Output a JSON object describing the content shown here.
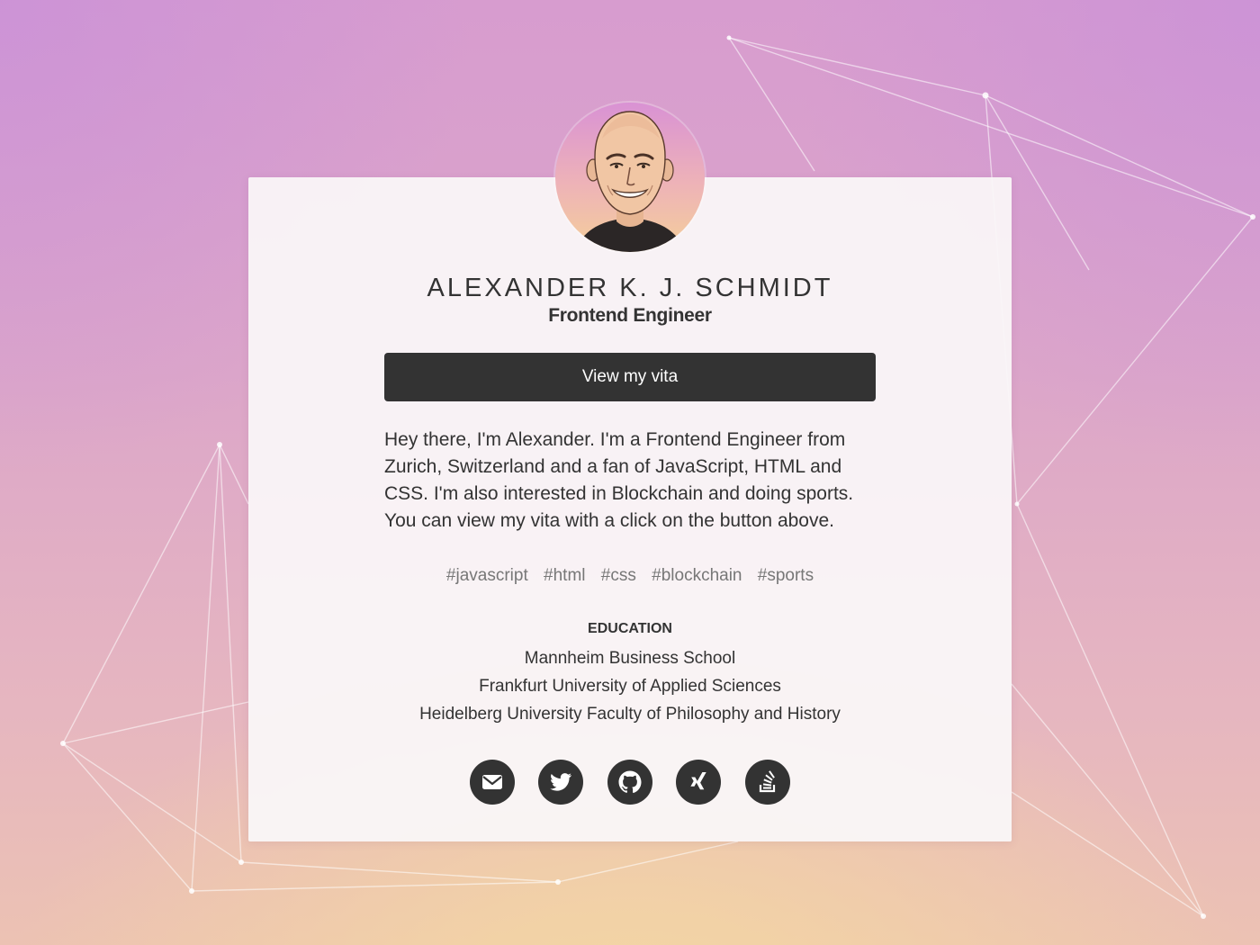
{
  "profile": {
    "name": "ALEXANDER K. J. SCHMIDT",
    "role": "Frontend Engineer",
    "avatar_icon": "avatar-illustration"
  },
  "vita_button": {
    "label": "View my vita"
  },
  "bio": {
    "lines": [
      "Hey there, I'm Alexander. I'm a Frontend Engineer from",
      "Zurich, Switzerland and a fan of JavaScript, HTML and",
      "CSS. I'm also interested in Blockchain and doing sports.",
      "You can view my vita with a click on the button above."
    ]
  },
  "tags": [
    "#javascript",
    "#html",
    "#css",
    "#blockchain",
    "#sports"
  ],
  "education": {
    "title": "EDUCATION",
    "items": [
      "Mannheim Business School",
      "Frankfurt University of Applied Sciences",
      "Heidelberg University Faculty of Philosophy and History"
    ]
  },
  "social_links": [
    {
      "icon": "mail-icon"
    },
    {
      "icon": "twitter-icon"
    },
    {
      "icon": "github-icon"
    },
    {
      "icon": "xing-icon"
    },
    {
      "icon": "stackoverflow-icon"
    }
  ],
  "colors": {
    "button_bg": "#333333",
    "text": "#333333",
    "tag_text": "#777777",
    "card_bg": "#faf6f8",
    "background_top": "#d79ccf",
    "background_bottom": "#f4d7a2"
  }
}
